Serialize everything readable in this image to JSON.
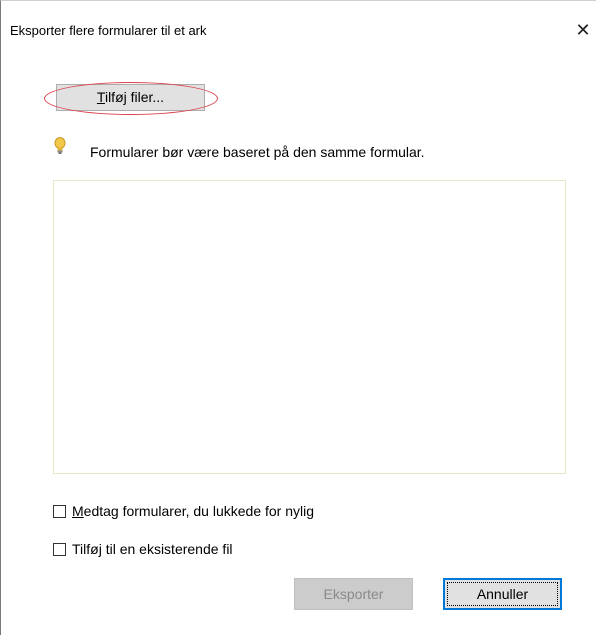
{
  "dialog": {
    "title": "Eksporter flere formularer til et ark",
    "close_label": "✕"
  },
  "add_files": {
    "label_underlined": "T",
    "label_rest": "ilføj filer..."
  },
  "hint": {
    "icon": "lightbulb-icon",
    "text": "Formularer bør være baseret på den samme formular."
  },
  "file_list": {
    "items": []
  },
  "options": {
    "include_recent": {
      "label_underlined": "M",
      "label_rest": "edtag formularer, du lukkede for nylig",
      "checked": false
    },
    "append_existing": {
      "label": "Tilføj til en eksisterende fil",
      "checked": false
    }
  },
  "buttons": {
    "export": "Eksporter",
    "cancel": "Annuller"
  },
  "colors": {
    "highlight": "#d9434f",
    "focus": "#0078d7",
    "button_face": "#e1e1e1",
    "disabled_face": "#cccccc"
  }
}
